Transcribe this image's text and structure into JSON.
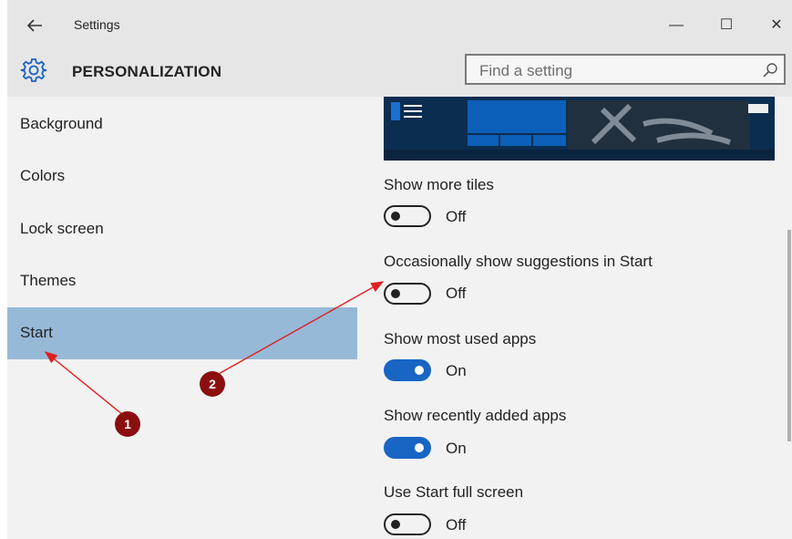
{
  "window": {
    "title": "Settings",
    "back_icon": "arrow-left-icon",
    "controls": {
      "minimize": "—",
      "maximize": "☐",
      "close": "✕"
    }
  },
  "header": {
    "section_title": "PERSONALIZATION",
    "icon": "gear-icon",
    "search_placeholder": "Find a setting"
  },
  "sidebar": {
    "items": [
      {
        "label": "Background",
        "active": false
      },
      {
        "label": "Colors",
        "active": false
      },
      {
        "label": "Lock screen",
        "active": false
      },
      {
        "label": "Themes",
        "active": false
      },
      {
        "label": "Start",
        "active": true
      }
    ]
  },
  "settings": [
    {
      "label": "Show more tiles",
      "state": "Off",
      "on": false
    },
    {
      "label": "Occasionally show suggestions in Start",
      "state": "Off",
      "on": false
    },
    {
      "label": "Show most used apps",
      "state": "On",
      "on": true
    },
    {
      "label": "Show recently added apps",
      "state": "On",
      "on": true
    },
    {
      "label": "Use Start full screen",
      "state": "Off",
      "on": false
    }
  ],
  "annotations": {
    "marker1": "1",
    "marker2": "2"
  },
  "colors": {
    "accent": "#1865c4",
    "selection": "#96b9d8",
    "marker": "#8b0f0f"
  }
}
